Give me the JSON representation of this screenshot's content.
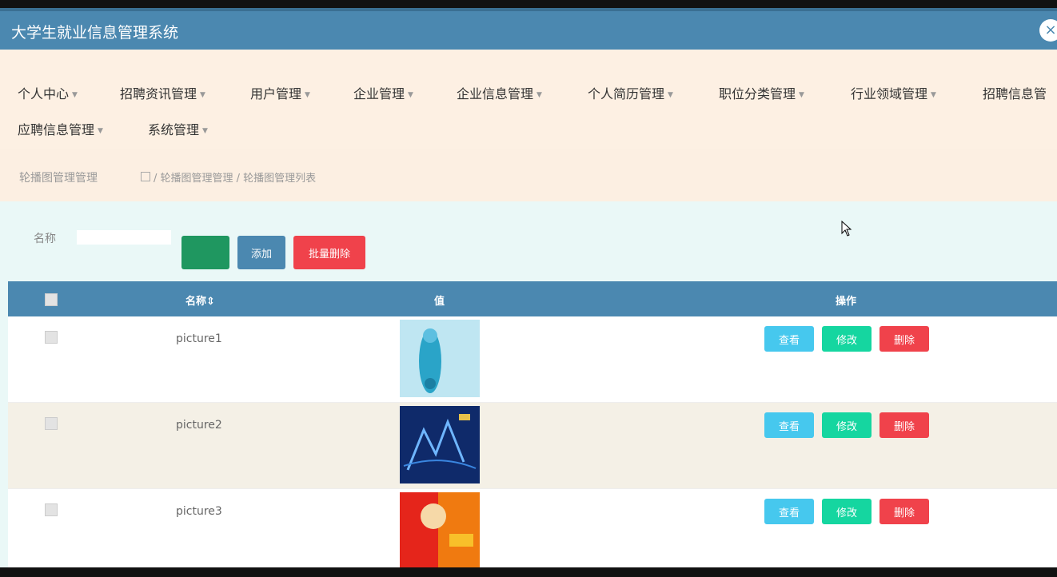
{
  "app": {
    "title": "大学生就业信息管理系统",
    "close_label": "×"
  },
  "nav": {
    "items": [
      {
        "label": "个人中心"
      },
      {
        "label": "招聘资讯管理"
      },
      {
        "label": "用户管理"
      },
      {
        "label": "企业管理"
      },
      {
        "label": "企业信息管理"
      },
      {
        "label": "个人简历管理"
      },
      {
        "label": "职位分类管理"
      },
      {
        "label": "行业领域管理"
      },
      {
        "label": "招聘信息管"
      },
      {
        "label": "应聘信息管理"
      },
      {
        "label": "系统管理"
      }
    ]
  },
  "breadcrumb": {
    "title": "轮播图管理管理",
    "path": "/ 轮播图管理管理 / 轮播图管理列表"
  },
  "search": {
    "label": "名称",
    "value": "",
    "search_button": "",
    "add_button": "添加",
    "batch_delete_button": "批量删除"
  },
  "table": {
    "headers": {
      "name": "名称",
      "value": "值",
      "actions": "操作"
    },
    "rows": [
      {
        "name": "picture1"
      },
      {
        "name": "picture2"
      },
      {
        "name": "picture3"
      }
    ],
    "actions": {
      "view": "查看",
      "edit": "修改",
      "delete": "删除"
    }
  },
  "colors": {
    "header_bg": "#4b88b0",
    "search_btn": "#1f9760",
    "danger": "#f0424b",
    "info": "#46c8ee",
    "success": "#15d6a0"
  }
}
